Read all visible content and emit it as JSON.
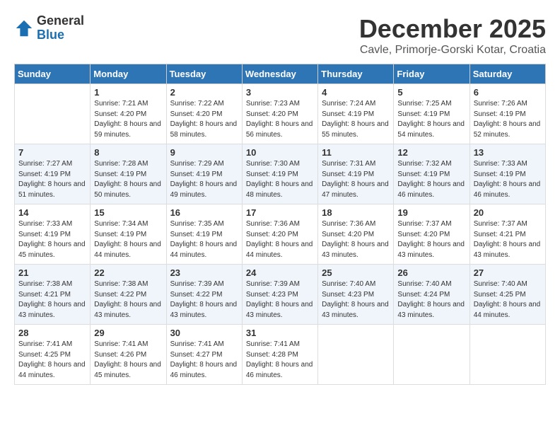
{
  "logo": {
    "general": "General",
    "blue": "Blue"
  },
  "title": "December 2025",
  "location": "Cavle, Primorje-Gorski Kotar, Croatia",
  "days_of_week": [
    "Sunday",
    "Monday",
    "Tuesday",
    "Wednesday",
    "Thursday",
    "Friday",
    "Saturday"
  ],
  "weeks": [
    [
      {
        "num": "",
        "sunrise": "",
        "sunset": "",
        "daylight": ""
      },
      {
        "num": "1",
        "sunrise": "Sunrise: 7:21 AM",
        "sunset": "Sunset: 4:20 PM",
        "daylight": "Daylight: 8 hours and 59 minutes."
      },
      {
        "num": "2",
        "sunrise": "Sunrise: 7:22 AM",
        "sunset": "Sunset: 4:20 PM",
        "daylight": "Daylight: 8 hours and 58 minutes."
      },
      {
        "num": "3",
        "sunrise": "Sunrise: 7:23 AM",
        "sunset": "Sunset: 4:20 PM",
        "daylight": "Daylight: 8 hours and 56 minutes."
      },
      {
        "num": "4",
        "sunrise": "Sunrise: 7:24 AM",
        "sunset": "Sunset: 4:19 PM",
        "daylight": "Daylight: 8 hours and 55 minutes."
      },
      {
        "num": "5",
        "sunrise": "Sunrise: 7:25 AM",
        "sunset": "Sunset: 4:19 PM",
        "daylight": "Daylight: 8 hours and 54 minutes."
      },
      {
        "num": "6",
        "sunrise": "Sunrise: 7:26 AM",
        "sunset": "Sunset: 4:19 PM",
        "daylight": "Daylight: 8 hours and 52 minutes."
      }
    ],
    [
      {
        "num": "7",
        "sunrise": "Sunrise: 7:27 AM",
        "sunset": "Sunset: 4:19 PM",
        "daylight": "Daylight: 8 hours and 51 minutes."
      },
      {
        "num": "8",
        "sunrise": "Sunrise: 7:28 AM",
        "sunset": "Sunset: 4:19 PM",
        "daylight": "Daylight: 8 hours and 50 minutes."
      },
      {
        "num": "9",
        "sunrise": "Sunrise: 7:29 AM",
        "sunset": "Sunset: 4:19 PM",
        "daylight": "Daylight: 8 hours and 49 minutes."
      },
      {
        "num": "10",
        "sunrise": "Sunrise: 7:30 AM",
        "sunset": "Sunset: 4:19 PM",
        "daylight": "Daylight: 8 hours and 48 minutes."
      },
      {
        "num": "11",
        "sunrise": "Sunrise: 7:31 AM",
        "sunset": "Sunset: 4:19 PM",
        "daylight": "Daylight: 8 hours and 47 minutes."
      },
      {
        "num": "12",
        "sunrise": "Sunrise: 7:32 AM",
        "sunset": "Sunset: 4:19 PM",
        "daylight": "Daylight: 8 hours and 46 minutes."
      },
      {
        "num": "13",
        "sunrise": "Sunrise: 7:33 AM",
        "sunset": "Sunset: 4:19 PM",
        "daylight": "Daylight: 8 hours and 46 minutes."
      }
    ],
    [
      {
        "num": "14",
        "sunrise": "Sunrise: 7:33 AM",
        "sunset": "Sunset: 4:19 PM",
        "daylight": "Daylight: 8 hours and 45 minutes."
      },
      {
        "num": "15",
        "sunrise": "Sunrise: 7:34 AM",
        "sunset": "Sunset: 4:19 PM",
        "daylight": "Daylight: 8 hours and 44 minutes."
      },
      {
        "num": "16",
        "sunrise": "Sunrise: 7:35 AM",
        "sunset": "Sunset: 4:19 PM",
        "daylight": "Daylight: 8 hours and 44 minutes."
      },
      {
        "num": "17",
        "sunrise": "Sunrise: 7:36 AM",
        "sunset": "Sunset: 4:20 PM",
        "daylight": "Daylight: 8 hours and 44 minutes."
      },
      {
        "num": "18",
        "sunrise": "Sunrise: 7:36 AM",
        "sunset": "Sunset: 4:20 PM",
        "daylight": "Daylight: 8 hours and 43 minutes."
      },
      {
        "num": "19",
        "sunrise": "Sunrise: 7:37 AM",
        "sunset": "Sunset: 4:20 PM",
        "daylight": "Daylight: 8 hours and 43 minutes."
      },
      {
        "num": "20",
        "sunrise": "Sunrise: 7:37 AM",
        "sunset": "Sunset: 4:21 PM",
        "daylight": "Daylight: 8 hours and 43 minutes."
      }
    ],
    [
      {
        "num": "21",
        "sunrise": "Sunrise: 7:38 AM",
        "sunset": "Sunset: 4:21 PM",
        "daylight": "Daylight: 8 hours and 43 minutes."
      },
      {
        "num": "22",
        "sunrise": "Sunrise: 7:38 AM",
        "sunset": "Sunset: 4:22 PM",
        "daylight": "Daylight: 8 hours and 43 minutes."
      },
      {
        "num": "23",
        "sunrise": "Sunrise: 7:39 AM",
        "sunset": "Sunset: 4:22 PM",
        "daylight": "Daylight: 8 hours and 43 minutes."
      },
      {
        "num": "24",
        "sunrise": "Sunrise: 7:39 AM",
        "sunset": "Sunset: 4:23 PM",
        "daylight": "Daylight: 8 hours and 43 minutes."
      },
      {
        "num": "25",
        "sunrise": "Sunrise: 7:40 AM",
        "sunset": "Sunset: 4:23 PM",
        "daylight": "Daylight: 8 hours and 43 minutes."
      },
      {
        "num": "26",
        "sunrise": "Sunrise: 7:40 AM",
        "sunset": "Sunset: 4:24 PM",
        "daylight": "Daylight: 8 hours and 43 minutes."
      },
      {
        "num": "27",
        "sunrise": "Sunrise: 7:40 AM",
        "sunset": "Sunset: 4:25 PM",
        "daylight": "Daylight: 8 hours and 44 minutes."
      }
    ],
    [
      {
        "num": "28",
        "sunrise": "Sunrise: 7:41 AM",
        "sunset": "Sunset: 4:25 PM",
        "daylight": "Daylight: 8 hours and 44 minutes."
      },
      {
        "num": "29",
        "sunrise": "Sunrise: 7:41 AM",
        "sunset": "Sunset: 4:26 PM",
        "daylight": "Daylight: 8 hours and 45 minutes."
      },
      {
        "num": "30",
        "sunrise": "Sunrise: 7:41 AM",
        "sunset": "Sunset: 4:27 PM",
        "daylight": "Daylight: 8 hours and 46 minutes."
      },
      {
        "num": "31",
        "sunrise": "Sunrise: 7:41 AM",
        "sunset": "Sunset: 4:28 PM",
        "daylight": "Daylight: 8 hours and 46 minutes."
      },
      {
        "num": "",
        "sunrise": "",
        "sunset": "",
        "daylight": ""
      },
      {
        "num": "",
        "sunrise": "",
        "sunset": "",
        "daylight": ""
      },
      {
        "num": "",
        "sunrise": "",
        "sunset": "",
        "daylight": ""
      }
    ]
  ]
}
